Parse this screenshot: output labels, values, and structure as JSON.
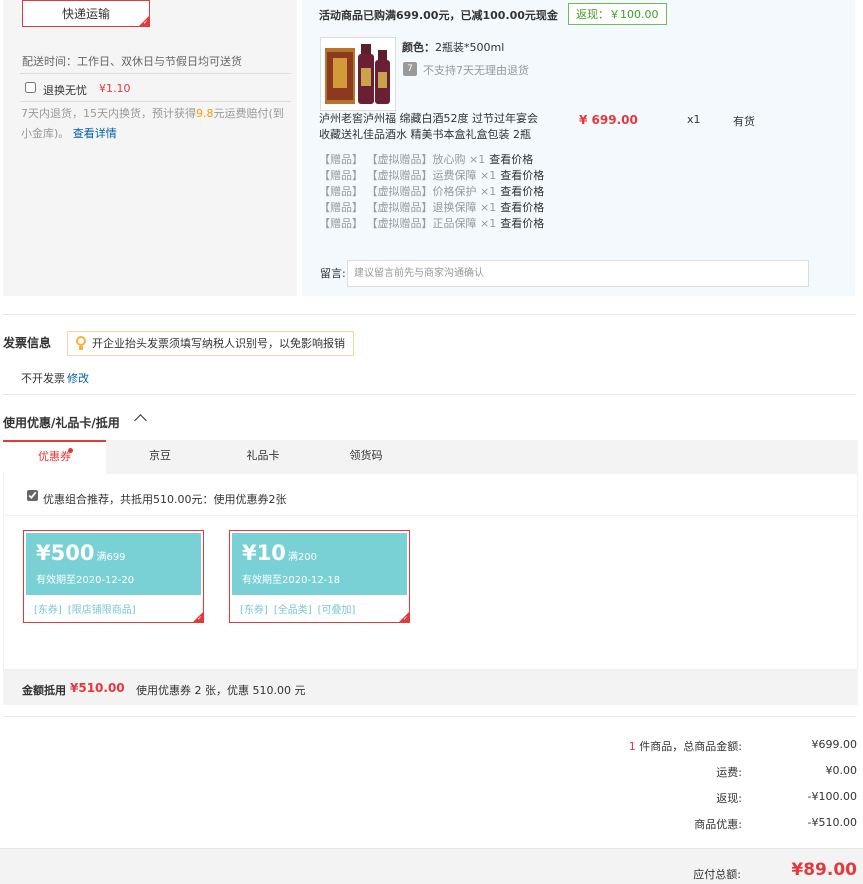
{
  "shipping": {
    "express_label": "快递运输",
    "delivery_time": "配送时间：工作日、双休日与节假日均可送货",
    "return_label": "退换无忧",
    "return_price": "¥1.10",
    "return_desc_part1": "7天内退货，15天内换货，预计获得",
    "return_desc_highlight": "9.8",
    "return_desc_part2": "元运费赔付(到小金库)。",
    "return_link": "查看详情"
  },
  "order": {
    "promo_text": "活动商品已购满699.00元，已减100.00元现金",
    "rebate_badge": "返现：￥100.00",
    "color_key": "颜色：",
    "color_value": "2瓶装*500ml",
    "no7_icon_text": "7",
    "no7_text": "不支持7天无理由退货",
    "product_name": "泸州老窖泸州福 绵藏白酒52度 过节过年宴会收藏送礼佳品酒水 精美书本盒礼盒包装 2瓶",
    "price": "¥ 699.00",
    "quantity": "x1",
    "stock": "有货",
    "gifts": [
      {
        "tag": "【赠品】",
        "name": "【虚拟赠品】放心购 ×1",
        "action": "查看价格"
      },
      {
        "tag": "【赠品】",
        "name": "【虚拟赠品】运费保障 ×1",
        "action": "查看价格"
      },
      {
        "tag": "【赠品】",
        "name": "【虚拟赠品】价格保护 ×1",
        "action": "查看价格"
      },
      {
        "tag": "【赠品】",
        "name": "【虚拟赠品】退换保障 ×1",
        "action": "查看价格"
      },
      {
        "tag": "【赠品】",
        "name": "【虚拟赠品】正品保障 ×1",
        "action": "查看价格"
      }
    ],
    "message_label": "留言:",
    "message_placeholder": "建议留言前先与商家沟通确认"
  },
  "invoice": {
    "title": "发票信息",
    "tip": "开企业抬头发票须填写纳税人识别号，以免影响报销",
    "status": "不开发票",
    "edit": "修改"
  },
  "coupons": {
    "title": "使用优惠/礼品卡/抵用",
    "tabs": [
      {
        "label": "优惠券"
      },
      {
        "label": "京豆"
      },
      {
        "label": "礼品卡"
      },
      {
        "label": "领货码"
      }
    ],
    "combo_text": "优惠组合推荐，共抵用510.00元：使用优惠券2张",
    "items": [
      {
        "amount": "¥500",
        "limit": "满699",
        "expiry": "有效期至2020-12-20",
        "tags": [
          "[东券]",
          "[限店铺限商品]"
        ]
      },
      {
        "amount": "¥10",
        "limit": "满200",
        "expiry": "有效期至2020-12-18",
        "tags": [
          "[东券]",
          "[全品类]",
          "[可叠加]"
        ]
      }
    ],
    "discount_label": "金额抵用",
    "discount_amount": "¥510.00",
    "discount_desc": "使用优惠券 2 张，优惠 510.00 元"
  },
  "summary": {
    "count": "1",
    "count_suffix": "件商品，总商品金额:",
    "goods_total": "¥699.00",
    "freight_label": "运费:",
    "freight": "¥0.00",
    "rebate_label": "返现:",
    "rebate": "-¥100.00",
    "discount_label": "商品优惠:",
    "discount": "-¥510.00",
    "payable_label": "应付总额:",
    "payable": "¥89.00"
  },
  "colors": {
    "accent": "#e4393c",
    "coupon": "#79d1d5",
    "link": "#005ea7"
  }
}
